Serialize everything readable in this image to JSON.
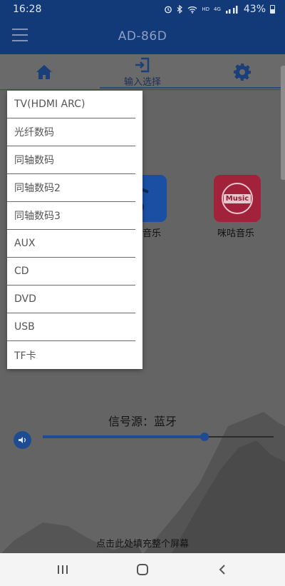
{
  "status_bar": {
    "time": "16:28",
    "indicators": [
      "alarm-icon",
      "bluetooth-icon",
      "wifi-icon",
      "HD",
      "4G",
      "signal-icon"
    ],
    "hd": "HD",
    "network": "4G",
    "battery": "43%"
  },
  "app_bar": {
    "title": "AD-86D",
    "menu_icon": "hamburger-menu-icon"
  },
  "tabs": {
    "home_icon": "home-icon",
    "input_label": "输入选择",
    "input_icon": "input-select-icon",
    "settings_icon": "gear-icon"
  },
  "input_menu": {
    "options": [
      "TV(HDMI ARC)",
      "光纤数码",
      "同轴数码",
      "同轴数码2",
      "同轴数码3",
      "AUX",
      "CD",
      "DVD",
      "USB",
      "TF卡"
    ]
  },
  "apps": {
    "local_music_label_partial": "音乐",
    "migu_label": "咪咕音乐",
    "migu_logo_word": "Music"
  },
  "player": {
    "signal_source": "信号源：蓝牙",
    "volume_level_percent": 70
  },
  "footer_hint": "点击此处填充整个屏幕",
  "colors": {
    "primary": "#123a78",
    "accent_blue": "#1e4c93",
    "migu_red": "#a3223b"
  },
  "nav_bar": {
    "recent_icon": "recent-apps-icon",
    "home_icon": "nav-home-icon",
    "back_icon": "back-icon"
  }
}
